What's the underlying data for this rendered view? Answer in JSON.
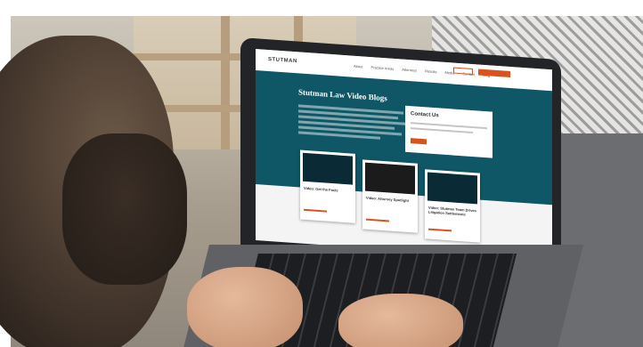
{
  "screen": {
    "logo": "STUTMAN",
    "nav_links": [
      "About",
      "Practice Areas",
      "Attorneys",
      "Results",
      "Media",
      "Contact",
      "Blog"
    ],
    "hero_title": "Stutman Law Video Blogs",
    "contact_box_title": "Contact Us",
    "cards": [
      {
        "caption": "Video: Get the Facts"
      },
      {
        "caption": "Video: Attorney Spotlight"
      },
      {
        "caption": "Video: Stutman Team Drives Litigation Settlements"
      }
    ]
  },
  "colors": {
    "hero_teal": "#0f5766",
    "accent_orange": "#d9531e"
  }
}
